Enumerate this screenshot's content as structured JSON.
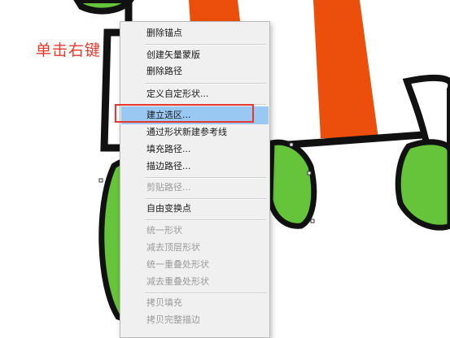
{
  "annotation": {
    "text": "单击右键",
    "color": "#e8372c"
  },
  "colors": {
    "outline": "#111111",
    "leaf_green": "#66c43a",
    "flag_orange": "#ec4e0c",
    "menu_bg": "#f0f0f0",
    "menu_hover": "#99c9f3",
    "highlight": "#e8372c"
  },
  "context_menu": {
    "items": [
      {
        "label": "删除锚点",
        "enabled": true
      },
      {
        "label": "创建矢量蒙版",
        "enabled": true
      },
      {
        "label": "删除路径",
        "enabled": true
      },
      {
        "label": "定义自定形状...",
        "enabled": true
      },
      {
        "label": "建立选区...",
        "enabled": true,
        "hovered": true
      },
      {
        "label": "通过形状新建参考线",
        "enabled": true
      },
      {
        "label": "填充路径...",
        "enabled": true
      },
      {
        "label": "描边路径...",
        "enabled": true
      },
      {
        "label": "剪贴路径...",
        "enabled": false
      },
      {
        "label": "自由变换点",
        "enabled": true
      },
      {
        "label": "统一形状",
        "enabled": false
      },
      {
        "label": "减去顶层形状",
        "enabled": false
      },
      {
        "label": "统一重叠处形状",
        "enabled": false
      },
      {
        "label": "减去重叠处形状",
        "enabled": false
      },
      {
        "label": "拷贝填充",
        "enabled": false
      },
      {
        "label": "拷贝完整描边",
        "enabled": false
      }
    ]
  }
}
